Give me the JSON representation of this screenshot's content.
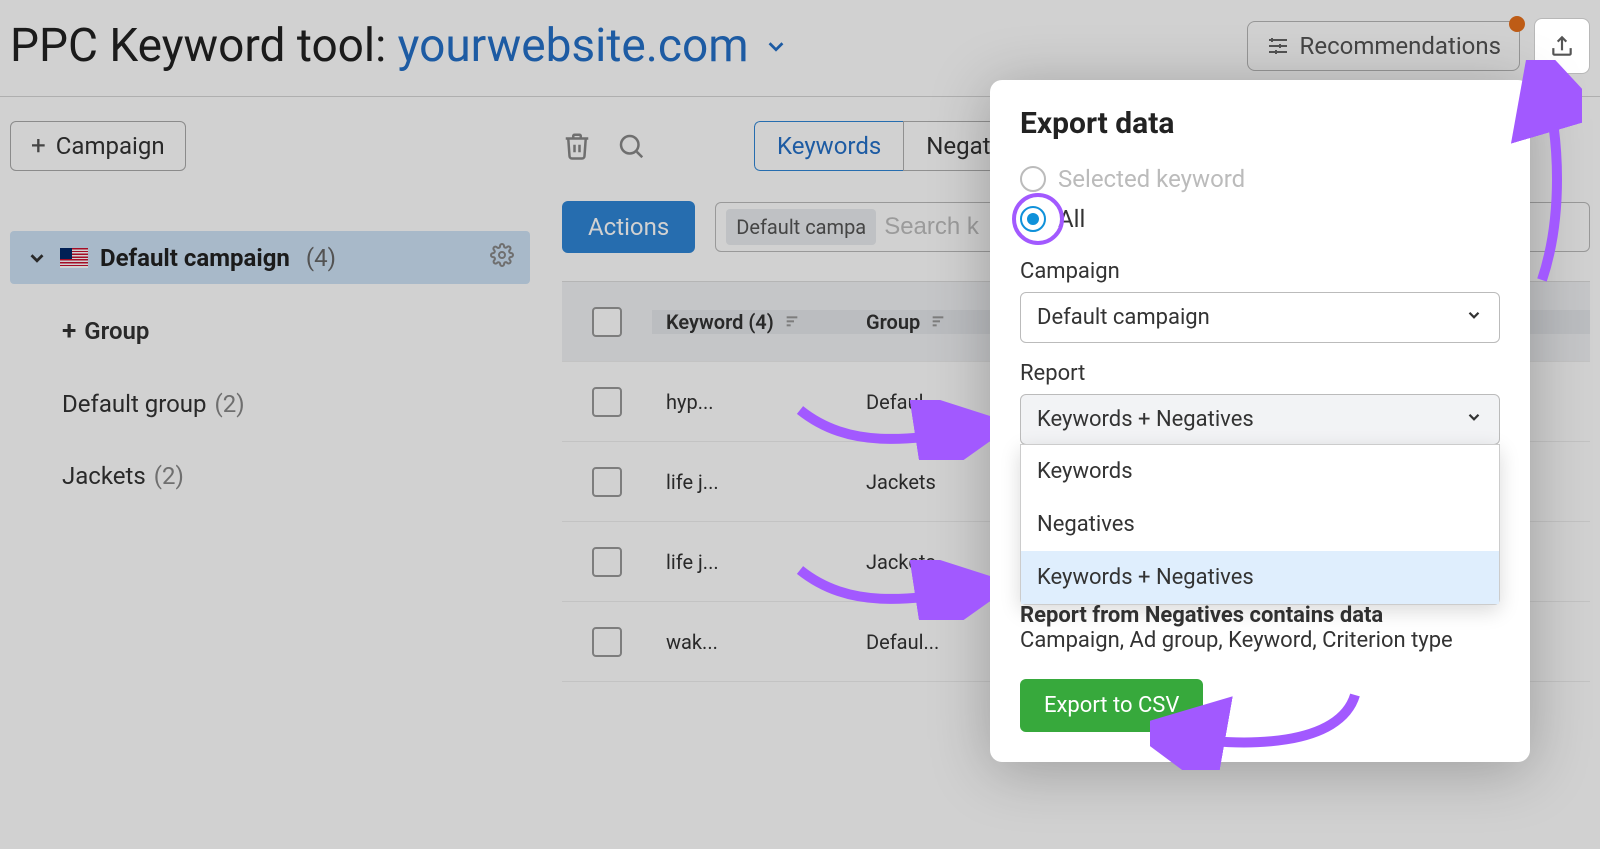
{
  "header": {
    "title_prefix": "PPC Keyword tool: ",
    "domain": "yourwebsite.com",
    "recommendations_label": "Recommendations"
  },
  "sidebar": {
    "add_campaign_label": "Campaign",
    "campaign": {
      "name": "Default campaign",
      "count": "(4)"
    },
    "add_group_label": "Group",
    "groups": [
      {
        "name": "Default group",
        "count": "(2)"
      },
      {
        "name": "Jackets",
        "count": "(2)"
      }
    ]
  },
  "tabs": {
    "keywords": "Keywords",
    "negatives": "Negatives"
  },
  "actions_label": "Actions",
  "search": {
    "chip": "Default campa",
    "placeholder": "Search k"
  },
  "table": {
    "header_keyword": "Keyword (4)",
    "header_group": "Group",
    "rows": [
      {
        "keyword": "hyp...",
        "group": "Defaul..."
      },
      {
        "keyword": "life j...",
        "group": "Jackets"
      },
      {
        "keyword": "life j...",
        "group": "Jackets"
      },
      {
        "keyword": "wak...",
        "group": "Defaul..."
      }
    ]
  },
  "popover": {
    "title": "Export data",
    "radio_selected_label": "Selected keyword",
    "radio_all_label": "All",
    "campaign_label": "Campaign",
    "campaign_value": "Default campaign",
    "report_label": "Report",
    "report_value": "Keywords + Negatives",
    "report_options": [
      "Keywords",
      "Negatives",
      "Keywords + Negatives"
    ],
    "note_bold": "Report from Negatives contains data",
    "note_body": "Campaign, Ad group, Keyword, Criterion type",
    "export_label": "Export to CSV"
  }
}
